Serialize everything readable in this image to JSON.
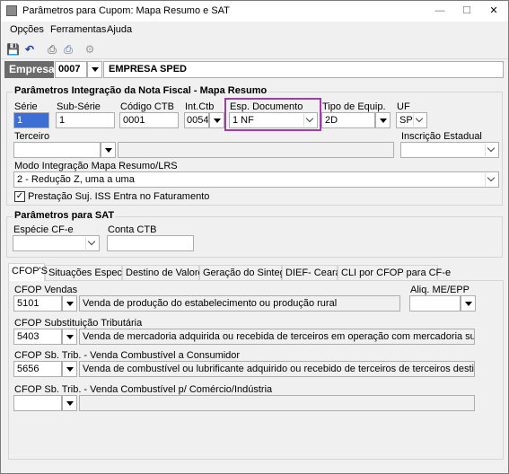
{
  "window": {
    "title": "Parâmetros para Cupom: Mapa Resumo e SAT",
    "minimize": "—",
    "maximize": "☐",
    "close": "✕"
  },
  "menu": [
    "Opções",
    "Ferramentas",
    "Ajuda"
  ],
  "toolbar": [
    {
      "name": "save-icon",
      "glyph": "💾",
      "color": "#1f3f9f"
    },
    {
      "name": "undo-icon",
      "glyph": "↶",
      "color": "#1f3f9f"
    },
    {
      "name": "print-icon",
      "glyph": "⎙",
      "color": "#444444"
    },
    {
      "name": "print-preview-icon",
      "glyph": "⎙",
      "color": "#444444"
    },
    {
      "name": "settings-icon",
      "glyph": "⚙",
      "color": "#9a9a9a"
    }
  ],
  "empresa": {
    "label": "Empresa",
    "code": "0007",
    "name": "EMPRESA SPED"
  },
  "integracao": {
    "legend": "Parâmetros Integração da Nota Fiscal - Mapa Resumo",
    "serie_label": "Série",
    "serie_value": "1",
    "subserie_label": "Sub-Série",
    "subserie_value": "1",
    "codctb_label": "Código CTB",
    "codctb_value": "0001",
    "intctb_label": "Int.Ctb",
    "intctb_value": "0054",
    "espdoc_label": "Esp. Documento",
    "espdoc_value": "1 NF",
    "tipoequip_label": "Tipo de Equip.",
    "tipoequip_value": "2D",
    "uf_label": "UF",
    "uf_value": "SP",
    "terceiro_label": "Terceiro",
    "terceiro_value": "",
    "inscricao_label": "Inscrição Estadual",
    "inscricao_value": "",
    "modo_label": "Modo Integração Mapa Resumo/LRS",
    "modo_value": "2 - Redução Z, uma a uma",
    "prestacao_label": "Prestação Suj. ISS Entra no Faturamento",
    "prestacao_checked": "✓"
  },
  "sat": {
    "legend": "Parâmetros para SAT",
    "especie_label": "Espécie CF-e",
    "especie_value": "",
    "conta_label": "Conta CTB",
    "conta_value": ""
  },
  "tabs": [
    "CFOP'S",
    "Situações Especiais",
    "Destino de Valores",
    "Geração do Sintegra",
    "DIEF- Ceará",
    "CLI por CFOP para CF-e"
  ],
  "cfops": {
    "vendas_label": "CFOP Vendas",
    "vendas_code": "5101",
    "vendas_desc": "Venda de produção do estabelecimento ou produção rural",
    "aliq_label": "Aliq. ME/EPP",
    "aliq_value": "",
    "subst_label": "CFOP Substituição Tributária",
    "subst_code": "5403",
    "subst_desc": "Venda de mercadoria adquirida ou recebida de terceiros em operação com mercadoria sujeita ao regime de s",
    "comb_label": "CFOP Sb. Trib. - Venda Combustível a Consumidor",
    "comb_code": "5656",
    "comb_desc": "Venda de combustível ou lubrificante adquirido ou recebido de terceiros de terceiros destinado a consumidor",
    "comb_com_label": "CFOP Sb. Trib. - Venda Combustível p/ Comércio/Indústria",
    "comb_com_code": "",
    "comb_com_desc": ""
  },
  "colors": {
    "highlight": "#9b3fa3",
    "empresa_label_bg": "#6b6b6b"
  }
}
